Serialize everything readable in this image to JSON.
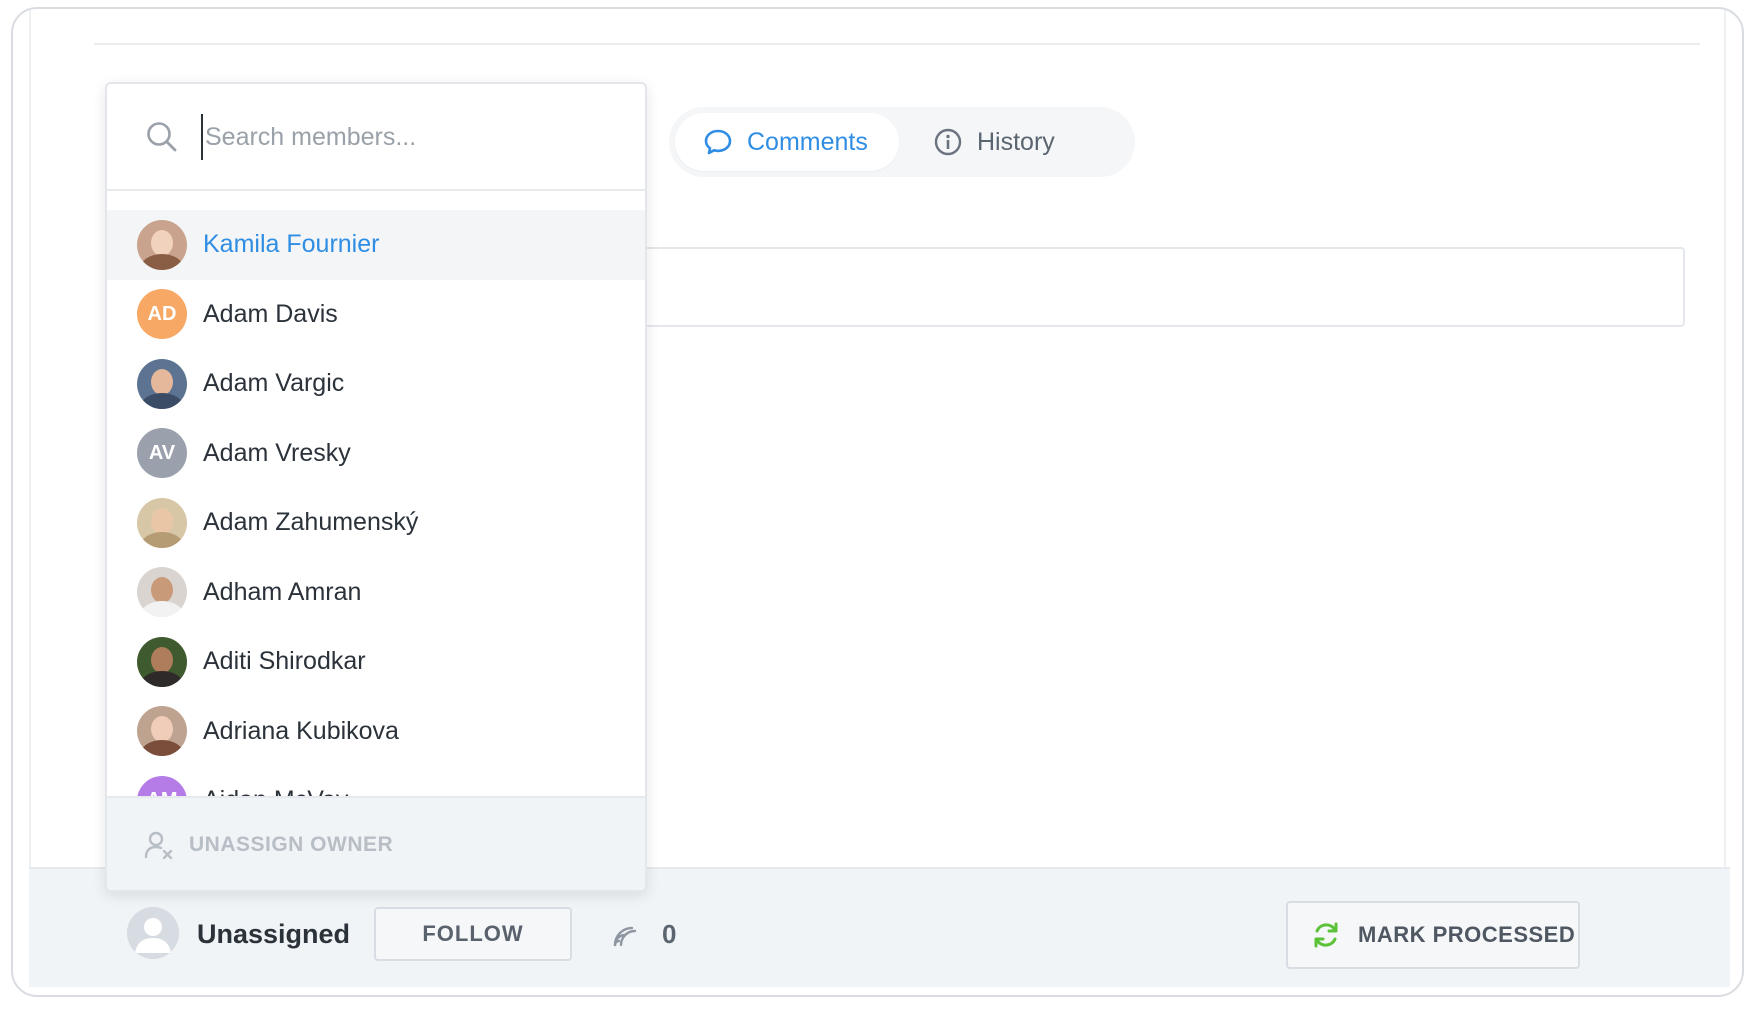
{
  "tabs": {
    "comments_label": "Comments",
    "history_label": "History"
  },
  "dropdown": {
    "search_placeholder": "Search members...",
    "members": [
      {
        "name": "Kamila Fournier",
        "avatar_type": "photo",
        "highlighted": true
      },
      {
        "name": "Adam Davis",
        "avatar_type": "initials",
        "initials": "AD",
        "color": "#f7a864"
      },
      {
        "name": "Adam Vargic",
        "avatar_type": "photo"
      },
      {
        "name": "Adam Vresky",
        "avatar_type": "initials",
        "initials": "AV",
        "color": "#9aa1ad"
      },
      {
        "name": "Adam Zahumenský",
        "avatar_type": "photo"
      },
      {
        "name": "Adham Amran",
        "avatar_type": "photo"
      },
      {
        "name": "Aditi Shirodkar",
        "avatar_type": "photo"
      },
      {
        "name": "Adriana Kubikova",
        "avatar_type": "photo"
      },
      {
        "name": "Aidan McVay",
        "avatar_type": "initials",
        "initials": "AM",
        "color": "#b57ce8"
      }
    ],
    "unassign_label": "UNASSIGN OWNER"
  },
  "bottombar": {
    "owner_label": "Unassigned",
    "follow_label": "FOLLOW",
    "followers_count": "0",
    "mark_processed_label": "MARK PROCESSED"
  },
  "colors": {
    "accent": "#2f8de4",
    "refresh_icon": "#5cc238"
  }
}
